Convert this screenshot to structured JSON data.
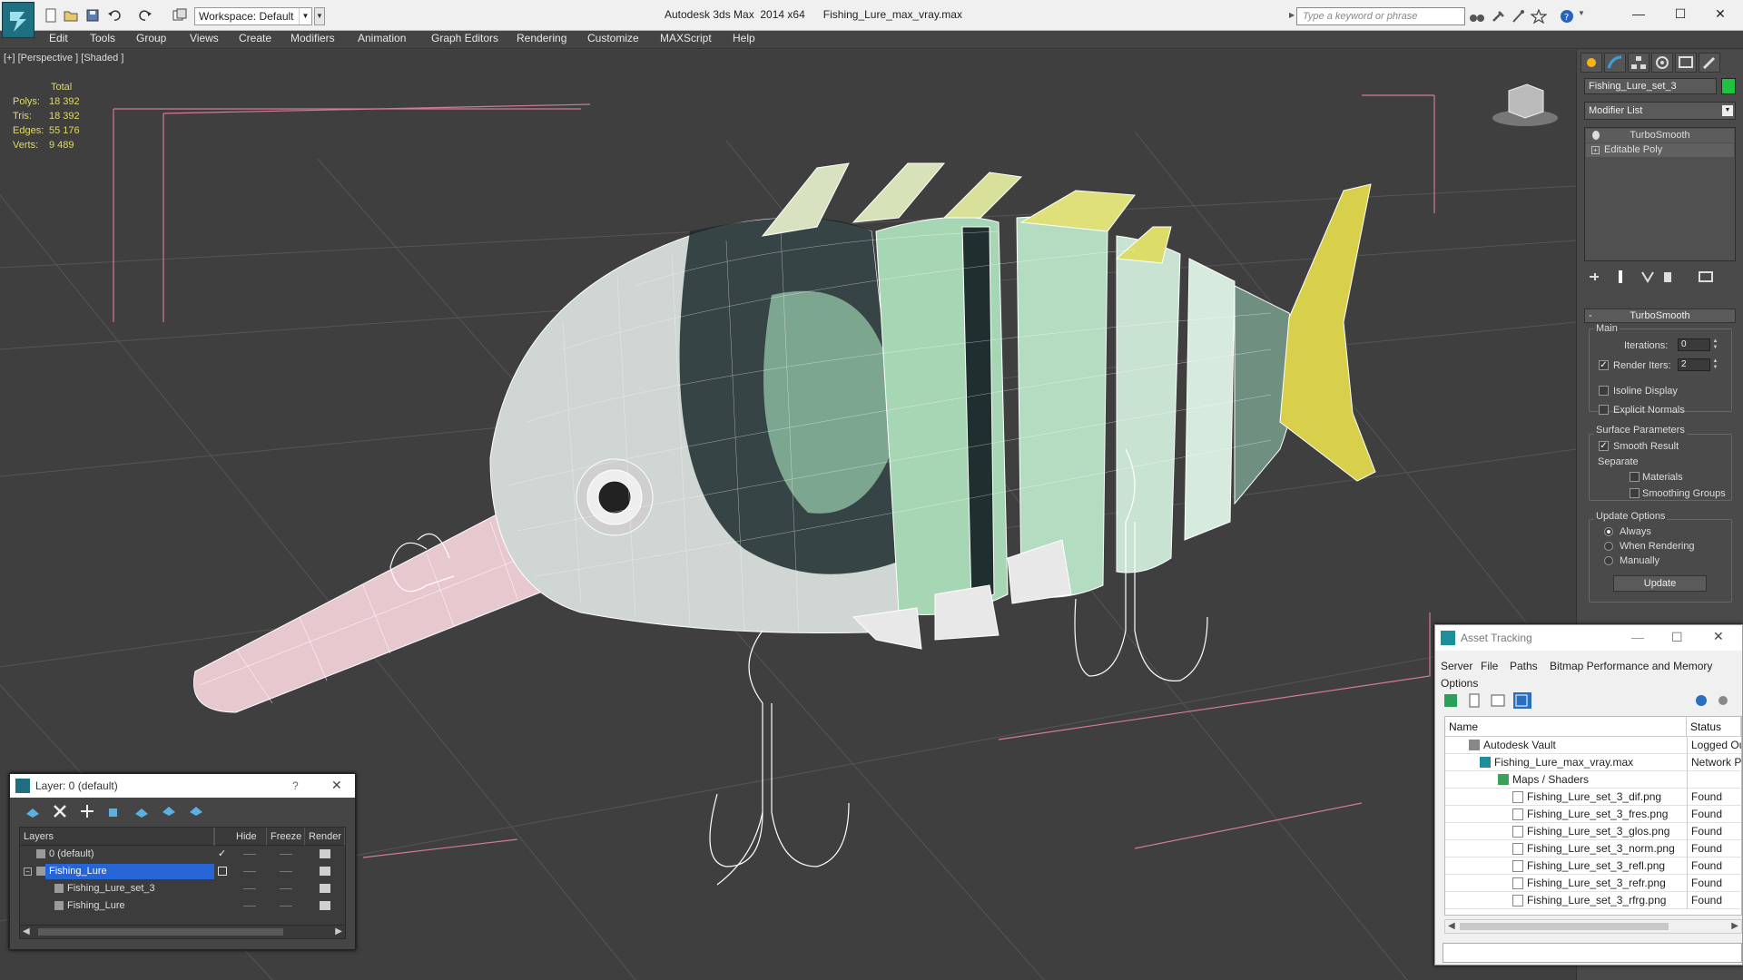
{
  "titlebar": {
    "workspace": "Workspace: Default",
    "app_title": "Autodesk 3ds Max  2014 x64      Fishing_Lure_max_vray.max",
    "search_placeholder": "Type a keyword or phrase"
  },
  "menu": [
    "Edit",
    "Tools",
    "Group",
    "Views",
    "Create",
    "Modifiers",
    "Animation",
    "Graph Editors",
    "Rendering",
    "Customize",
    "MAXScript",
    "Help"
  ],
  "viewport": {
    "label": "[+] [Perspective ] [Shaded ]",
    "stats": {
      "header": "Total",
      "polys_label": "Polys:",
      "polys": "18 392",
      "tris_label": "Tris:",
      "tris": "18 392",
      "edges_label": "Edges:",
      "edges": "55 176",
      "verts_label": "Verts:",
      "verts": "9 489"
    }
  },
  "command_panel": {
    "object_name": "Fishing_Lure_set_3",
    "object_color": "#20c040",
    "modifier_list": "Modifier List",
    "stack": [
      "TurboSmooth",
      "Editable Poly"
    ],
    "rollout_title": "TurboSmooth",
    "main_group": "Main",
    "iterations_label": "Iterations:",
    "iterations_value": "0",
    "render_iters_label": "Render Iters:",
    "render_iters_value": "2",
    "isoline_display": "Isoline Display",
    "explicit_normals": "Explicit Normals",
    "surface_group": "Surface Parameters",
    "smooth_result": "Smooth Result",
    "separate": "Separate",
    "materials": "Materials",
    "smoothing_groups": "Smoothing Groups",
    "update_group": "Update Options",
    "always": "Always",
    "when_rendering": "When Rendering",
    "manually": "Manually",
    "update_button": "Update"
  },
  "layer_dialog": {
    "title": "Layer: 0 (default)",
    "help": "?",
    "columns": [
      "Layers",
      "Hide",
      "Freeze",
      "Render"
    ],
    "rows": [
      {
        "name": "0 (default)"
      },
      {
        "name": "Fishing_Lure"
      },
      {
        "name": "Fishing_Lure_set_3"
      },
      {
        "name": "Fishing_Lure"
      }
    ]
  },
  "asset_tracking": {
    "title": "Asset Tracking",
    "menu": [
      "Server",
      "File",
      "Paths",
      "Bitmap Performance and Memory",
      "Options"
    ],
    "columns": [
      "Name",
      "Status"
    ],
    "rows": [
      {
        "name": "Autodesk Vault",
        "status": "Logged Out"
      },
      {
        "name": "Fishing_Lure_max_vray.max",
        "status": "Network Path"
      },
      {
        "name": "Maps / Shaders",
        "status": ""
      },
      {
        "name": "Fishing_Lure_set_3_dif.png",
        "status": "Found"
      },
      {
        "name": "Fishing_Lure_set_3_fres.png",
        "status": "Found"
      },
      {
        "name": "Fishing_Lure_set_3_glos.png",
        "status": "Found"
      },
      {
        "name": "Fishing_Lure_set_3_norm.png",
        "status": "Found"
      },
      {
        "name": "Fishing_Lure_set_3_refl.png",
        "status": "Found"
      },
      {
        "name": "Fishing_Lure_set_3_refr.png",
        "status": "Found"
      },
      {
        "name": "Fishing_Lure_set_3_rfrg.png",
        "status": "Found"
      }
    ]
  }
}
